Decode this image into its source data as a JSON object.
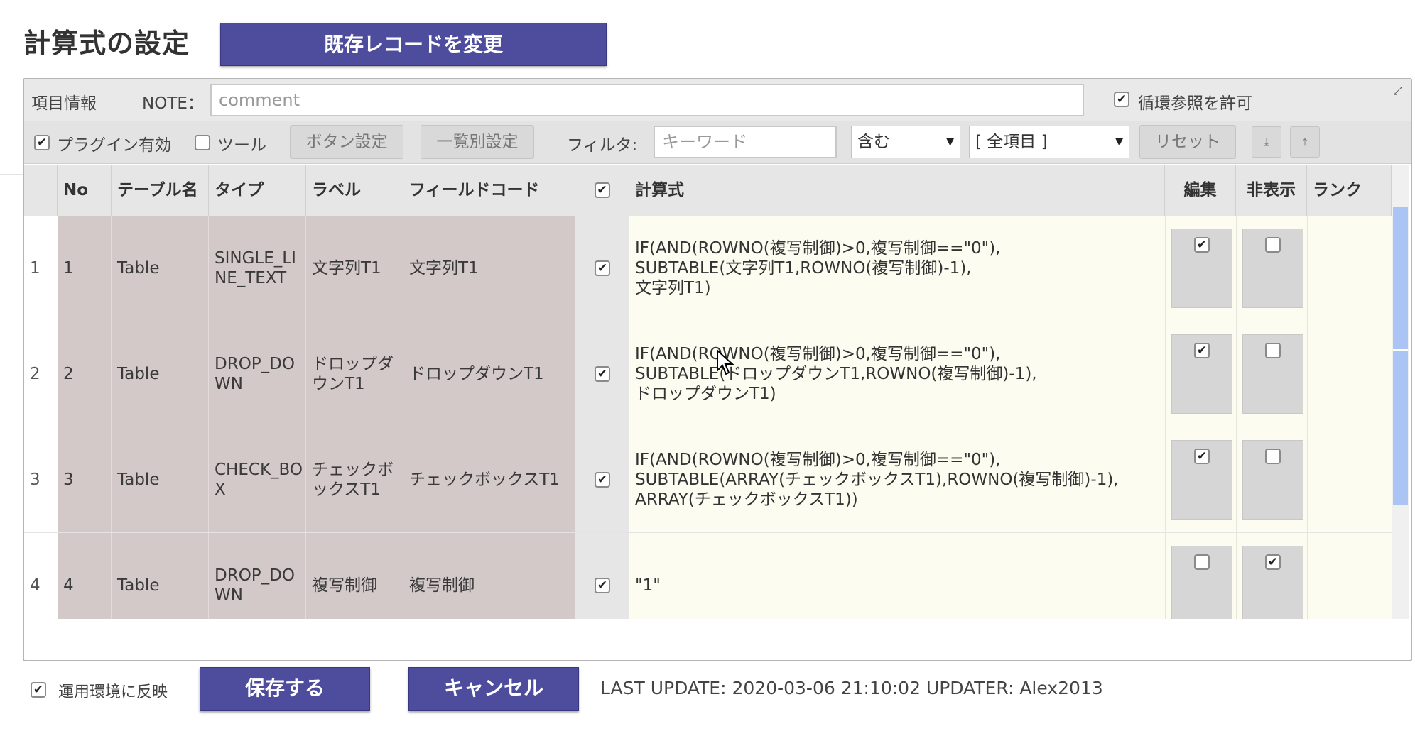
{
  "header": {
    "title": "計算式の設定",
    "change_button": "既存レコードを変更"
  },
  "bar1": {
    "item_info": "項目情報",
    "note_label": "NOTE：",
    "note_placeholder": "comment",
    "circular_label": "循環参照を許可",
    "circular_checked": true
  },
  "bar2": {
    "plugin_label": "プラグイン有効",
    "plugin_checked": true,
    "tool_label": "ツール",
    "tool_checked": false,
    "button_settings": "ボタン設定",
    "list_settings": "一覧別設定",
    "filter_label": "フィルタ:",
    "keyword_placeholder": "キーワード",
    "match_select": "含む",
    "field_select": "[ 全項目 ]",
    "reset_button": "リセット",
    "icon_bottom": "⤓",
    "icon_top": "⤒"
  },
  "table": {
    "headers": {
      "no": "No",
      "table_name": "テーブル名",
      "type": "タイプ",
      "label": "ラベル",
      "field_code": "フィールドコード",
      "formula": "計算式",
      "edit": "編集",
      "hidden": "非表示",
      "rank": "ランク"
    },
    "rows": [
      {
        "rownum": "1",
        "no": "1",
        "table_name": "Table",
        "type": "SINGLE_LINE_TEXT",
        "label": "文字列T1",
        "field_code": "文字列T1",
        "checked": true,
        "formula": "IF(AND(ROWNO(複写制御)>0,複写制御==\"0\"),\nSUBTABLE(文字列T1,ROWNO(複写制御)-1),\n文字列T1)",
        "edit": true,
        "hidden": false
      },
      {
        "rownum": "2",
        "no": "2",
        "table_name": "Table",
        "type": "DROP_DOWN",
        "label": "ドロップダウンT1",
        "field_code": "ドロップダウンT1",
        "checked": true,
        "formula": "IF(AND(ROWNO(複写制御)>0,複写制御==\"0\"),\nSUBTABLE(ドロップダウンT1,ROWNO(複写制御)-1),\nドロップダウンT1)",
        "edit": true,
        "hidden": false
      },
      {
        "rownum": "3",
        "no": "3",
        "table_name": "Table",
        "type": "CHECK_BOX",
        "label": "チェックボックスT1",
        "field_code": "チェックボックスT1",
        "checked": true,
        "formula": "IF(AND(ROWNO(複写制御)>0,複写制御==\"0\"),\nSUBTABLE(ARRAY(チェックボックスT1),ROWNO(複写制御)-1),\nARRAY(チェックボックスT1))",
        "edit": true,
        "hidden": false
      },
      {
        "rownum": "4",
        "no": "4",
        "table_name": "Table",
        "type": "DROP_DOWN",
        "label": "複写制御",
        "field_code": "複写制御",
        "checked": true,
        "formula": "\"1\"",
        "edit": false,
        "hidden": true
      }
    ]
  },
  "footer": {
    "apply_label": "運用環境に反映",
    "apply_checked": true,
    "save_button": "保存する",
    "cancel_button": "キャンセル",
    "last_update": "LAST UPDATE: 2020-03-06 21:10:02 UPDATER: Alex2013"
  },
  "colors": {
    "primary_button": "#4e4c9c",
    "locked_cell": "#d3c9c8",
    "formula_bg": "#fcfcf1",
    "scroll_thumb": "#aac4f3"
  }
}
